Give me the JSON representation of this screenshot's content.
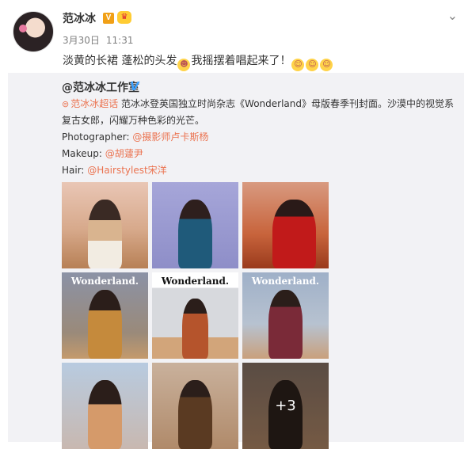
{
  "post": {
    "username": "范冰冰",
    "verified_mark": "V",
    "date": "3月30日",
    "time": "11:31",
    "text_part1": "淡黄的长裙 蓬松的头发",
    "text_part2": "我摇摆着唱起来了！"
  },
  "repost": {
    "username": "@范冰冰工作室",
    "topic": "范冰冰超话",
    "body_line1": " 范冰冰登英国独立时尚杂志《Wonderland》母版春季刊封面。沙漠中的视觉系",
    "body_line2": "复古女郎，闪耀万种色彩的光芒。",
    "photographer_label": "Photographer: ",
    "photographer": "@摄影师卢卡斯杨",
    "makeup_label": "Makeup: ",
    "makeup": "@胡蘧尹",
    "hair_label": "Hair: ",
    "hair": "@Hairstylest宋洋",
    "more_count": "+3"
  },
  "magazine": {
    "title": "Wonderland."
  },
  "colors": {
    "link": "#eb7350",
    "verified": "#f1a016",
    "blue_v": "#3ba1ff"
  }
}
